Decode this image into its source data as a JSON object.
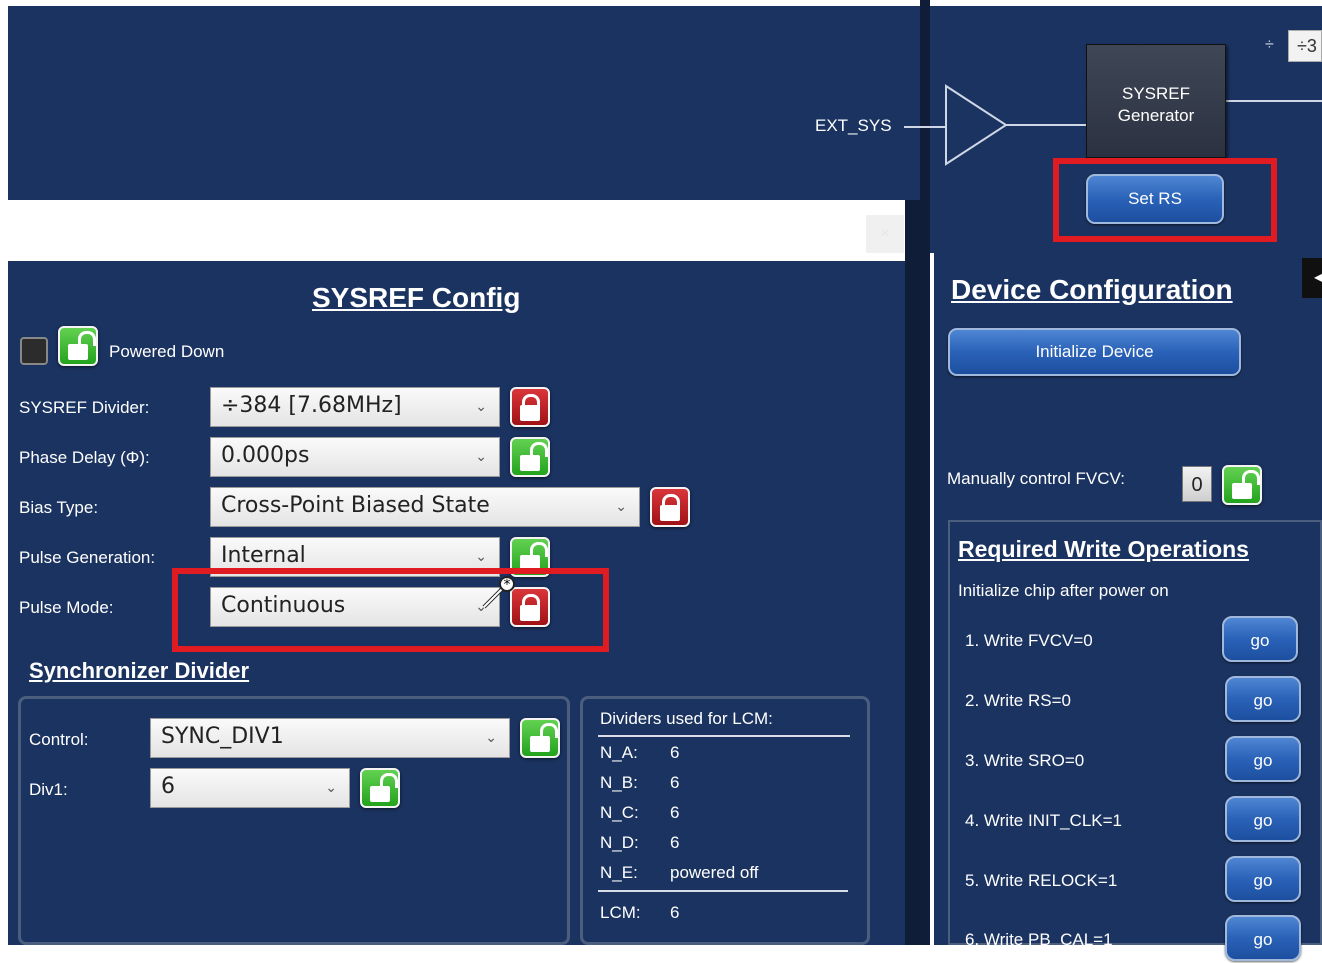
{
  "diagram": {
    "ext_sys_label": "EXT_SYS",
    "generator_line1": "SYSREF",
    "generator_line2": "Generator",
    "set_rs_label": "Set RS",
    "divide_symbol": "÷",
    "divide_box_partial": "÷3"
  },
  "dialog": {
    "close_glyph": "×",
    "title": "SYSREF Config",
    "powered_down_label": "Powered Down",
    "rows": {
      "divider": {
        "label": "SYSREF Divider:",
        "value": "÷384 [7.68MHz]",
        "lock": "locked"
      },
      "phase_delay": {
        "label": "Phase Delay (Φ):",
        "value": "0.000ps",
        "lock": "unlocked"
      },
      "bias_type": {
        "label": "Bias Type:",
        "value": "Cross-Point Biased State",
        "lock": "locked"
      },
      "pulse_generation": {
        "label": "Pulse Generation:",
        "value": "Internal",
        "lock": "unlocked"
      },
      "pulse_mode": {
        "label": "Pulse Mode:",
        "value": "Continuous",
        "lock": "locked"
      }
    },
    "sync_title": "Synchronizer Divider",
    "sync": {
      "control_label": "Control:",
      "control_value": "SYNC_DIV1",
      "div1_label": "Div1:",
      "div1_value": "6"
    },
    "lcm": {
      "title": "Dividers used for LCM:",
      "rows": [
        {
          "k": "N_A:",
          "v": "6"
        },
        {
          "k": "N_B:",
          "v": "6"
        },
        {
          "k": "N_C:",
          "v": "6"
        },
        {
          "k": "N_D:",
          "v": "6"
        },
        {
          "k": "N_E:",
          "v": "powered off"
        }
      ],
      "lcm_label": "LCM:",
      "lcm_value": "6"
    }
  },
  "device": {
    "title": "Device Configuration",
    "init_label": "Initialize Device",
    "fvcv_label": "Manually control FVCV:",
    "fvcv_value": "0",
    "rwo_title": "Required Write Operations",
    "rwo_subtitle": "Initialize chip after power on",
    "steps": [
      {
        "label": "1.  Write FVCV=0",
        "go": "go"
      },
      {
        "label": "2.  Write RS=0",
        "go": "go"
      },
      {
        "label": "3.  Write SRO=0",
        "go": "go"
      },
      {
        "label": "4.  Write INIT_CLK=1",
        "go": "go"
      },
      {
        "label": "5.  Write RELOCK=1",
        "go": "go"
      },
      {
        "label": "6.  Write PB_CAL=1",
        "go": "go"
      }
    ],
    "arrow_glyph": "◂"
  },
  "colors": {
    "panel_bg": "#1b3360",
    "highlight_red": "#e01b22",
    "lock_green": "#23a31d",
    "lock_red": "#a01216",
    "button_blue": "#2a62b8"
  }
}
